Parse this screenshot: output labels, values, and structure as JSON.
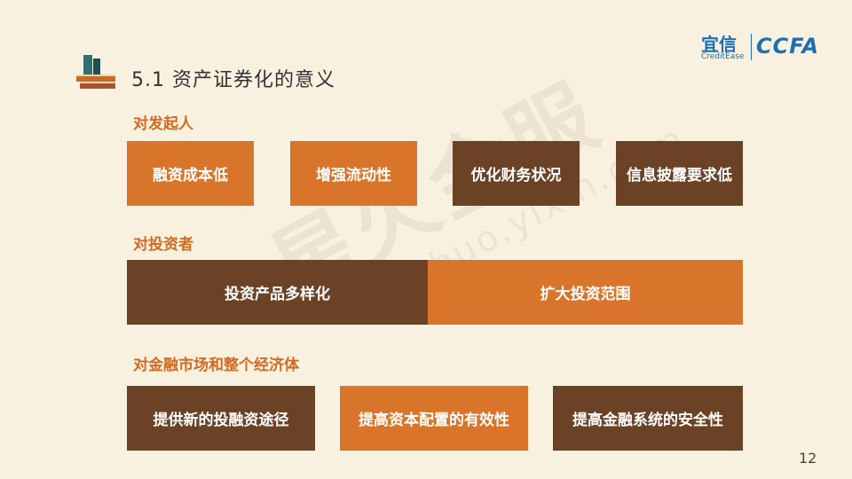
{
  "title": "5.1 资产证券化的意义",
  "logo": {
    "cn": "宜信",
    "en": "CreditEase",
    "ccfa": "CCFA"
  },
  "watermark": {
    "cn": "星火金服",
    "url": "xinghuo.yixin.com"
  },
  "sections": {
    "issuer": {
      "label": "对发起人",
      "items": [
        "融资成本低",
        "增强流动性",
        "优化财务状况",
        "信息披露要求低"
      ]
    },
    "investor": {
      "label": "对投资者",
      "items": [
        "投资产品多样化",
        "扩大投资范围"
      ]
    },
    "market": {
      "label": "对金融市场和整个经济体",
      "items": [
        "提供新的投融资途径",
        "提高资本配置的有效性",
        "提高金融系统的安全性"
      ]
    }
  },
  "colors": {
    "orange": "#d8752b",
    "brown": "#6b4225",
    "accent_text": "#d36a1f",
    "background": "#f8f1df"
  },
  "page_number": "12"
}
